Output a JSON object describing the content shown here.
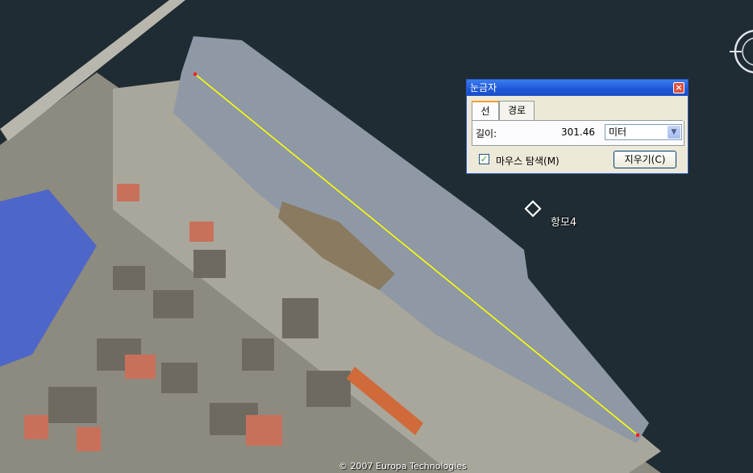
{
  "ruler_dialog": {
    "title": "눈금자",
    "close": "×",
    "tabs": [
      {
        "label": "선"
      },
      {
        "label": "경로"
      }
    ],
    "length_label": "길이:",
    "length_value": "301.46",
    "unit": "미터",
    "mouse_nav_label": "마우스 탐색(M)",
    "mouse_nav_checked": true,
    "clear_label": "지우기(C)"
  },
  "placemark": {
    "label": "항모4"
  },
  "copyright": "© 2007 Europa Technologies",
  "colors": {
    "measure_line": "#ffff00",
    "endpoint": "#ff2020",
    "title_bar": "#1d56d6"
  },
  "icons": [
    "close-icon",
    "checkbox-checked-icon",
    "dropdown-arrow-icon",
    "placemark-diamond-icon",
    "navigation-compass-icon"
  ]
}
